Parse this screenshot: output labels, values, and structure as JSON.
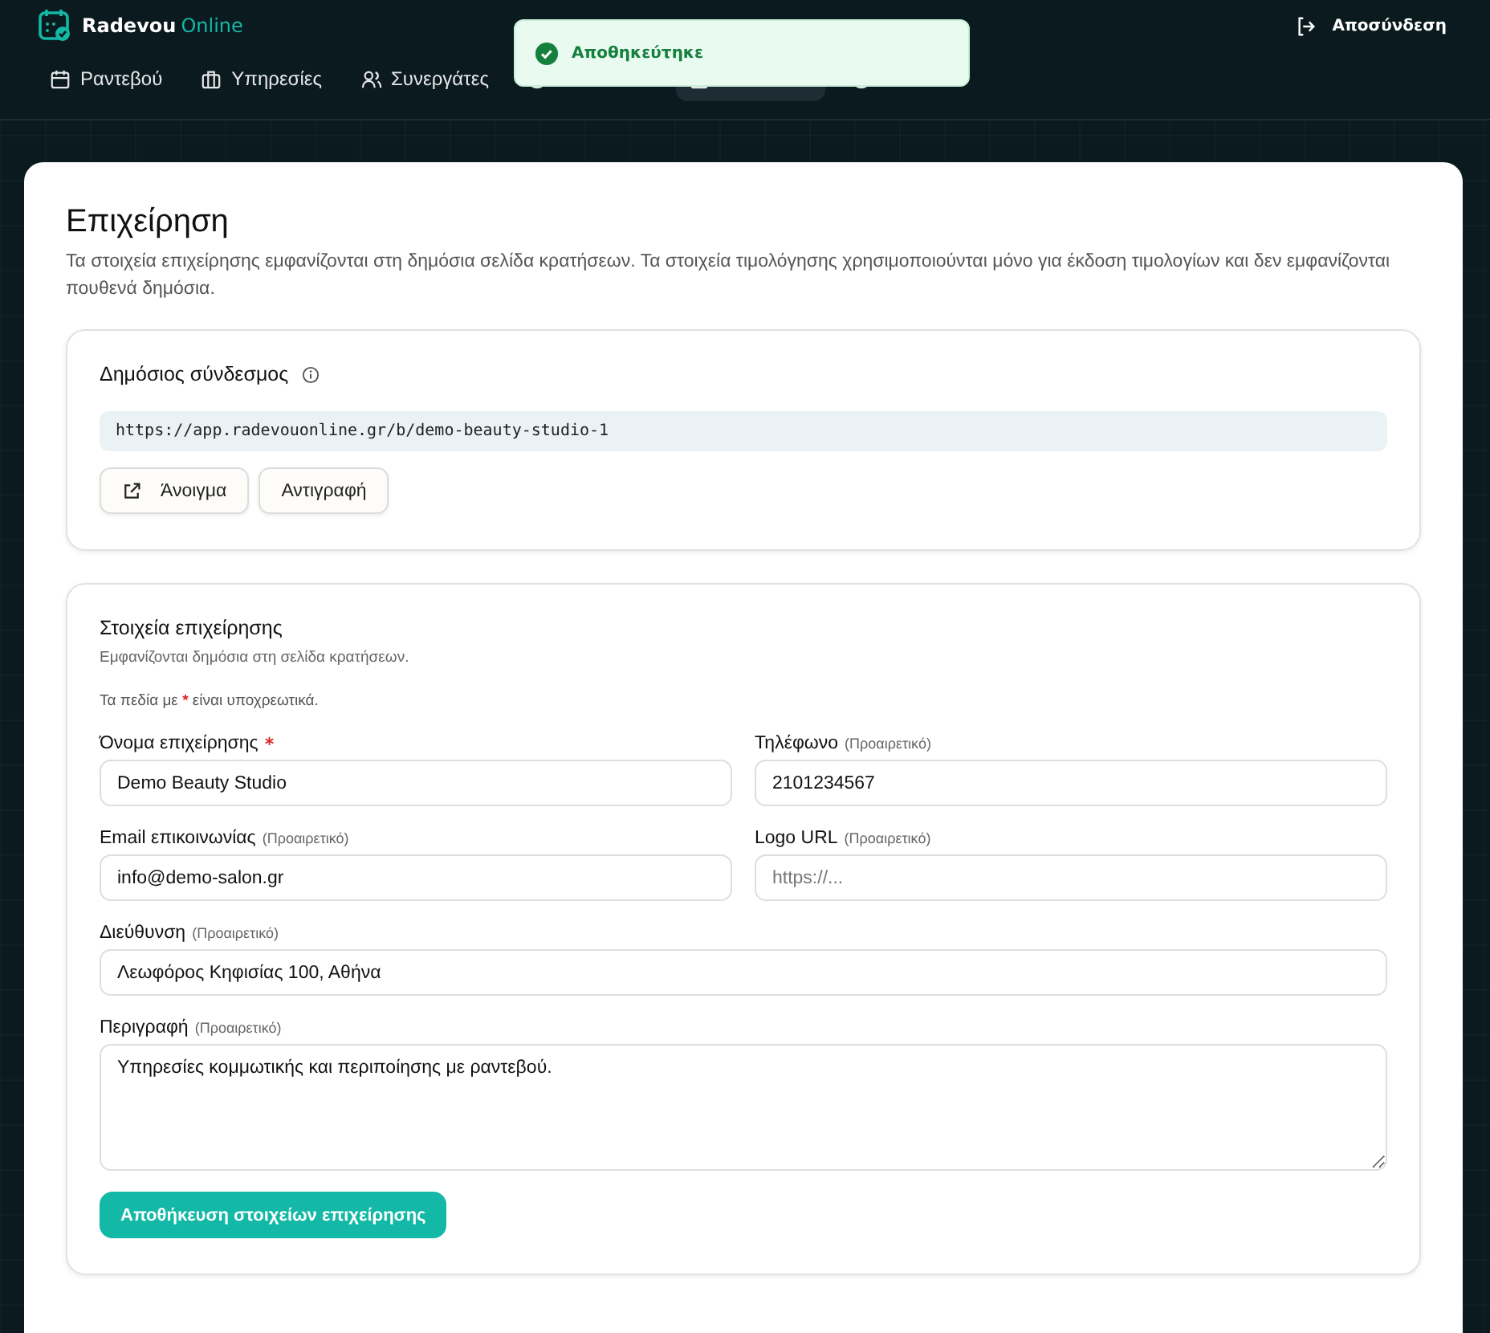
{
  "brand": {
    "name": "Radevou",
    "suffix": "Online"
  },
  "logout": "Αποσύνδεση",
  "nav": [
    {
      "label": "Ραντεβού",
      "selected": false
    },
    {
      "label": "Υπηρεσίες",
      "selected": false
    },
    {
      "label": "Συνεργάτες",
      "selected": false
    },
    {
      "selected": false
    },
    {
      "selected": true
    },
    {
      "selected": false
    }
  ],
  "toast": {
    "message": "Αποθηκεύτηκε"
  },
  "page": {
    "title": "Επιχείρηση",
    "description": "Τα στοιχεία επιχείρησης εμφανίζονται στη δημόσια σελίδα κρατήσεων. Τα στοιχεία τιμολόγησης χρησιμοποιούνται μόνο για έκδοση τιμολογίων και δεν εμφανίζονται πουθενά δημόσια."
  },
  "public_link": {
    "title": "Δημόσιος σύνδεσμος",
    "url": "https://app.radevouonline.gr/b/demo-beauty-studio-1",
    "open_button": "Άνοιγμα",
    "copy_button": "Αντιγραφή"
  },
  "details": {
    "title": "Στοιχεία επιχείρησης",
    "subtitle": "Εμφανίζονται δημόσια στη σελίδα κρατήσεων.",
    "required_note_before": "Τα πεδία με",
    "required_mark": "*",
    "required_note_after": "είναι υποχρεωτικά.",
    "fields": [
      {
        "label": "Όνομα επιχείρησης",
        "required": true,
        "value": "Demo Beauty Studio",
        "kind": "input"
      },
      {
        "label": "Τηλέφωνο",
        "optional": "(Προαιρετικό)",
        "value": "2101234567",
        "kind": "input"
      },
      {
        "label": "Email επικοινωνίας",
        "optional": "(Προαιρετικό)",
        "value": "info@demo-salon.gr",
        "kind": "input"
      },
      {
        "label": "Logo URL",
        "optional": "(Προαιρετικό)",
        "placeholder": "https://...",
        "kind": "input"
      },
      {
        "label": "Διεύθυνση",
        "optional": "(Προαιρετικό)",
        "value": "Λεωφόρος Κηφισίας 100, Αθήνα",
        "kind": "wide"
      },
      {
        "label": "Περιγραφή",
        "optional": "(Προαιρετικό)",
        "value": "Υπηρεσίες κομμωτικής και περιποίησης με ραντεβού.",
        "kind": "textarea"
      }
    ],
    "save_button": "Αποθήκευση στοιχείων επιχείρησης"
  }
}
